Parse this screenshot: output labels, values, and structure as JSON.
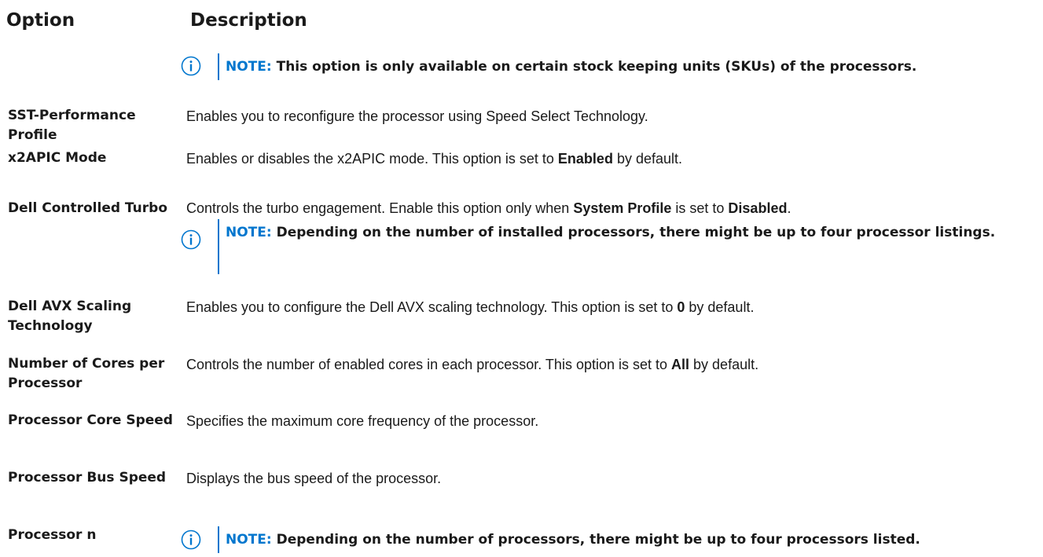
{
  "header": {
    "option": "Option",
    "description": "Description"
  },
  "note_label": "NOTE:",
  "top_note": "This option is only available on certain stock keeping units (SKUs) of the processors.",
  "rows": {
    "sst": {
      "option": "SST-Performance Profile",
      "description": "Enables you to reconfigure the processor using Speed Select Technology."
    },
    "x2apic": {
      "option": "x2APIC Mode",
      "desc_pre": "Enables or disables the x2APIC mode. This option is set to ",
      "desc_bold": "Enabled",
      "desc_post": " by default."
    },
    "turbo": {
      "option": "Dell Controlled Turbo",
      "desc_pre": "Controls the turbo engagement. Enable this option only when ",
      "desc_bold1": "System Profile",
      "desc_mid": " is set to ",
      "desc_bold2": "Disabled",
      "desc_post": ".",
      "note": "Depending on the number of installed processors, there might be up to four processor listings."
    },
    "avx": {
      "option": "Dell AVX Scaling Technology",
      "desc_pre": "Enables you to configure the Dell AVX scaling technology. This option is set to ",
      "desc_bold": "0",
      "desc_post": " by default."
    },
    "cores": {
      "option": "Number of Cores per Processor",
      "desc_pre": "Controls the number of enabled cores in each processor. This option is set to ",
      "desc_bold": "All",
      "desc_post": " by default."
    },
    "core_speed": {
      "option": "Processor Core Speed",
      "description": "Specifies the maximum core frequency of the processor."
    },
    "bus_speed": {
      "option": "Processor Bus Speed",
      "description": "Displays the bus speed of the processor."
    },
    "proc_n": {
      "option": "Processor n",
      "note": "Depending on the number of processors, there might be up to four processors listed."
    }
  },
  "icons": {
    "info": "info-icon"
  },
  "colors": {
    "note_accent": "#0076ce",
    "text": "#1a1a1a"
  }
}
